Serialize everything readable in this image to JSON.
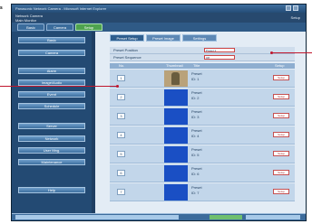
{
  "callout": {
    "label": "s"
  },
  "window": {
    "title": "Panasonic Network Camera - Microsoft Internet Explorer"
  },
  "header": {
    "line1": "Network Camera",
    "line2": "Main Monitor",
    "right": "Setup"
  },
  "topnav": {
    "tabs": [
      "Basic",
      "Camera",
      "Setup"
    ],
    "selected": 2
  },
  "sidebar": {
    "items": [
      "Basic",
      "Camera",
      "Alarm",
      "Image/Audio",
      "Event",
      "Schedule",
      "Server",
      "Network",
      "User Mng.",
      "Maintenance",
      "Help"
    ]
  },
  "main": {
    "tabs": [
      "Preset Setup",
      "Preset Image",
      "Settings"
    ],
    "settings": [
      {
        "label": "Preset Position",
        "value": "Preset 1"
      },
      {
        "label": "Preset Sequence",
        "value": "Off"
      }
    ],
    "columns": [
      "No.",
      "Thumbnail",
      "Title",
      "Setup"
    ],
    "rows": [
      {
        "no": "1",
        "title": "Preset",
        "sub": "ID: 1",
        "btn": "Setup",
        "photo": true
      },
      {
        "no": "2",
        "title": "Preset",
        "sub": "ID: 2",
        "btn": "Setup",
        "photo": false
      },
      {
        "no": "3",
        "title": "Preset",
        "sub": "ID: 3",
        "btn": "Setup",
        "photo": false
      },
      {
        "no": "4",
        "title": "Preset",
        "sub": "ID: 4",
        "btn": "Setup",
        "photo": false
      },
      {
        "no": "5",
        "title": "Preset",
        "sub": "ID: 5",
        "btn": "Setup",
        "photo": false
      },
      {
        "no": "6",
        "title": "Preset",
        "sub": "ID: 6",
        "btn": "Setup",
        "photo": false
      },
      {
        "no": "7",
        "title": "Preset",
        "sub": "ID: 7",
        "btn": "Setup",
        "photo": false
      }
    ]
  },
  "colors": {
    "frame": "#1f3f63",
    "accent": "#c0162c",
    "selected_tab": "#4fa34f",
    "thumb_blue": "#1a4fc4"
  }
}
